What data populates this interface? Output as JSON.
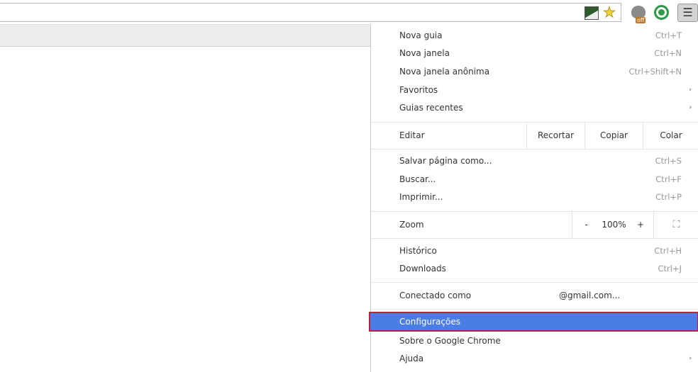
{
  "toolbar": {
    "icons": [
      "image-icon",
      "star-icon",
      "extension-owl-icon",
      "extension-green-icon",
      "menu-icon"
    ],
    "owl_badge": "off"
  },
  "menu": {
    "group1": [
      {
        "label": "Nova guia",
        "shortcut": "Ctrl+T"
      },
      {
        "label": "Nova janela",
        "shortcut": "Ctrl+N"
      },
      {
        "label": "Nova janela anônima",
        "shortcut": "Ctrl+Shift+N"
      },
      {
        "label": "Favoritos",
        "submenu": "›"
      },
      {
        "label": "Guias recentes",
        "submenu": "›"
      }
    ],
    "edit": {
      "label": "Editar",
      "cut": "Recortar",
      "copy": "Copiar",
      "paste": "Colar"
    },
    "group2": [
      {
        "label": "Salvar página como...",
        "shortcut": "Ctrl+S"
      },
      {
        "label": "Buscar...",
        "shortcut": "Ctrl+F"
      },
      {
        "label": "Imprimir...",
        "shortcut": "Ctrl+P"
      }
    ],
    "zoom": {
      "label": "Zoom",
      "minus": "-",
      "value": "100%",
      "plus": "+"
    },
    "group3": [
      {
        "label": "Histórico",
        "shortcut": "Ctrl+H"
      },
      {
        "label": "Downloads",
        "shortcut": "Ctrl+J"
      }
    ],
    "signed_in": {
      "label": "Conectado como",
      "account": "@gmail.com..."
    },
    "group4": [
      {
        "label": "Configurações"
      },
      {
        "label": "Sobre o Google Chrome"
      },
      {
        "label": "Ajuda",
        "submenu": "›"
      }
    ]
  }
}
